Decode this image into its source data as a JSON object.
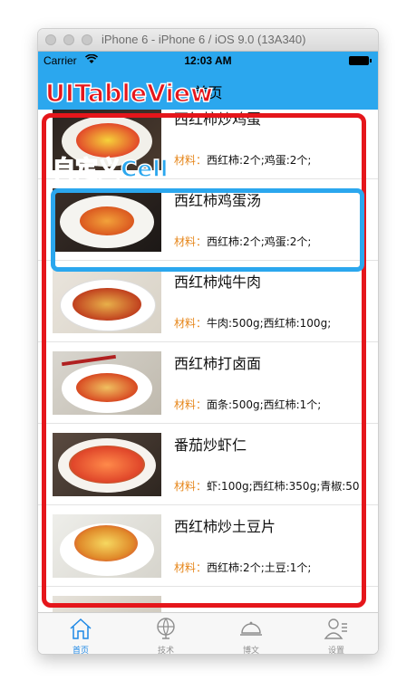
{
  "window": {
    "title": "iPhone 6 - iPhone 6 / iOS 9.0 (13A340)"
  },
  "statusbar": {
    "carrier": "Carrier",
    "time": "12:03 AM"
  },
  "navbar": {
    "title": "首页"
  },
  "annotations": {
    "tableview_label": "UITableView",
    "cell_label": "自定义Cell",
    "tableview_color": "#e5161b",
    "cell_color": "#2ba7ee"
  },
  "rows": [
    {
      "title": "西红柿炒鸡蛋",
      "material_label": "材料：",
      "material": "西红柿:2个;鸡蛋:2个;"
    },
    {
      "title": "西红柿鸡蛋汤",
      "material_label": "材料：",
      "material": "西红柿:2个;鸡蛋:2个;"
    },
    {
      "title": "西红柿炖牛肉",
      "material_label": "材料：",
      "material": "牛肉:500g;西红柿:100g;"
    },
    {
      "title": "西红柿打卤面",
      "material_label": "材料：",
      "material": "面条:500g;西红柿:1个;"
    },
    {
      "title": "番茄炒虾仁",
      "material_label": "材料：",
      "material": "虾:100g;西红柿:350g;青椒:50"
    },
    {
      "title": "西红柿炒土豆片",
      "material_label": "材料：",
      "material": "西红柿:2个;土豆:1个;"
    }
  ],
  "tabbar": {
    "items": [
      {
        "label": "首页",
        "icon": "home-icon",
        "active": true
      },
      {
        "label": "技术",
        "icon": "globe-icon",
        "active": false
      },
      {
        "label": "博文",
        "icon": "dome-icon",
        "active": false
      },
      {
        "label": "设置",
        "icon": "profile-icon",
        "active": false
      }
    ],
    "active_color": "#1e88e5"
  },
  "colors": {
    "navbar": "#2ba7ee",
    "material_label": "#e6861a"
  }
}
